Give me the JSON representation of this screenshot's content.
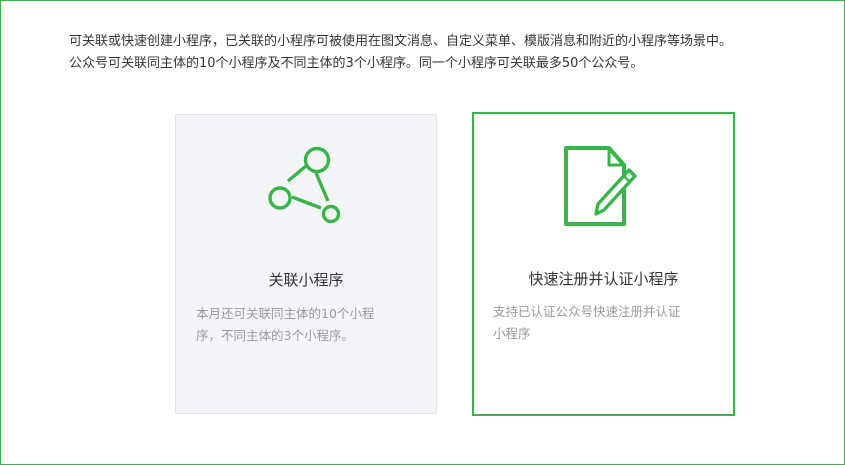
{
  "intro": {
    "line1": "可关联或快速创建小程序，已关联的小程序可被使用在图文消息、自定义菜单、模版消息和附近的小程序等场景中。",
    "line2": "公众号可关联同主体的10个小程序及不同主体的3个小程序。同一个小程序可关联最多50个公众号。"
  },
  "cards": {
    "link": {
      "icon": "network-graph-icon",
      "title": "关联小程序",
      "desc_line1": "本月还可关联同主体的10个小程",
      "desc_line2": "序，不同主体的3个小程序。"
    },
    "register": {
      "icon": "document-pen-icon",
      "title": "快速注册并认证小程序",
      "desc_line1": "支持已认证公众号快速注册并认证",
      "desc_line2": "小程序"
    }
  },
  "colors": {
    "accent": "#38b449",
    "text": "#353535",
    "muted": "#9a9a9a",
    "card_bg": "#f4f5f9"
  }
}
